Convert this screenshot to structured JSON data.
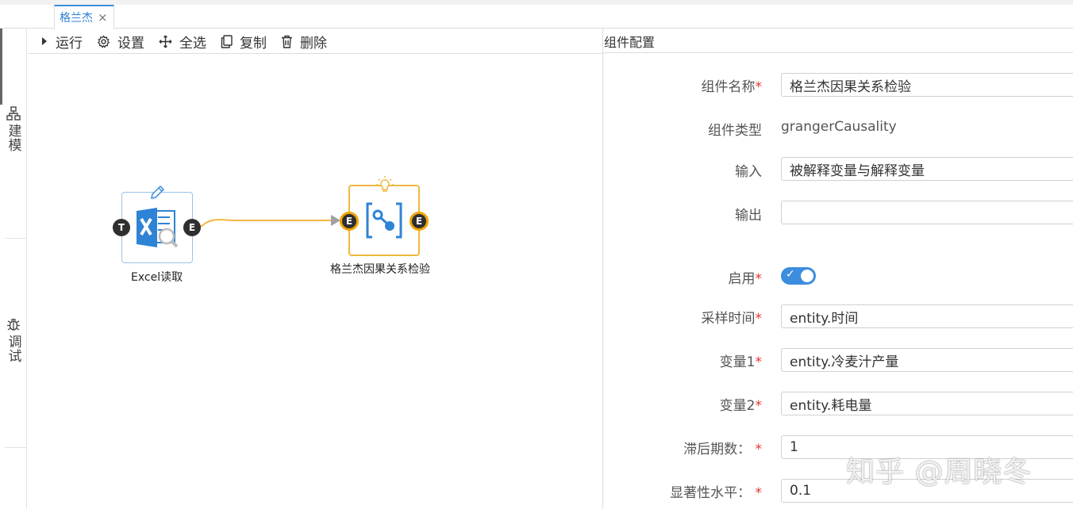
{
  "tabs": [
    {
      "label": "格兰杰",
      "close": "×"
    }
  ],
  "side_tabs": [
    {
      "label": "建模",
      "icon": "sitemap-icon"
    },
    {
      "label": "调试",
      "icon": "bug-icon"
    }
  ],
  "toolbar": {
    "run": "运行",
    "settings": "设置",
    "select_all": "全选",
    "copy": "复制",
    "delete": "删除"
  },
  "nodes": [
    {
      "label": "Excel读取",
      "icon": "excel-search-icon",
      "ports": {
        "in": "T",
        "out": "E"
      }
    },
    {
      "label": "格兰杰因果关系检验",
      "icon": "causality-icon",
      "ports": {
        "in": "E",
        "out": "E"
      }
    }
  ],
  "colors": {
    "accent": "#3c8dde",
    "selected_node": "#f0b840",
    "edge": "#f0b840",
    "required": "#e3342f"
  },
  "panel": {
    "title": "组件配置",
    "fields": [
      {
        "label": "组件名称",
        "required": true,
        "value": "格兰杰因果关系检验",
        "type": "input"
      },
      {
        "label": "组件类型",
        "required": false,
        "value": "grangerCausality",
        "type": "text"
      },
      {
        "label": "输入",
        "required": false,
        "value": "被解释变量与解释变量",
        "type": "input"
      },
      {
        "label": "输出",
        "required": false,
        "value": "",
        "type": "input"
      },
      {
        "label": "启用",
        "required": true,
        "value": true,
        "type": "switch"
      },
      {
        "label": "采样时间",
        "required": true,
        "value": "entity.时间",
        "type": "input"
      },
      {
        "label": "变量1",
        "required": true,
        "value": "entity.冷麦汁产量",
        "type": "input"
      },
      {
        "label": "变量2",
        "required": true,
        "value": "entity.耗电量",
        "type": "input"
      },
      {
        "label": "滞后期数：",
        "required": true,
        "value": "1",
        "type": "input"
      },
      {
        "label": "显著性水平：",
        "required": true,
        "value": "0.1",
        "type": "input"
      }
    ]
  },
  "watermark": "知乎 @周晓冬"
}
